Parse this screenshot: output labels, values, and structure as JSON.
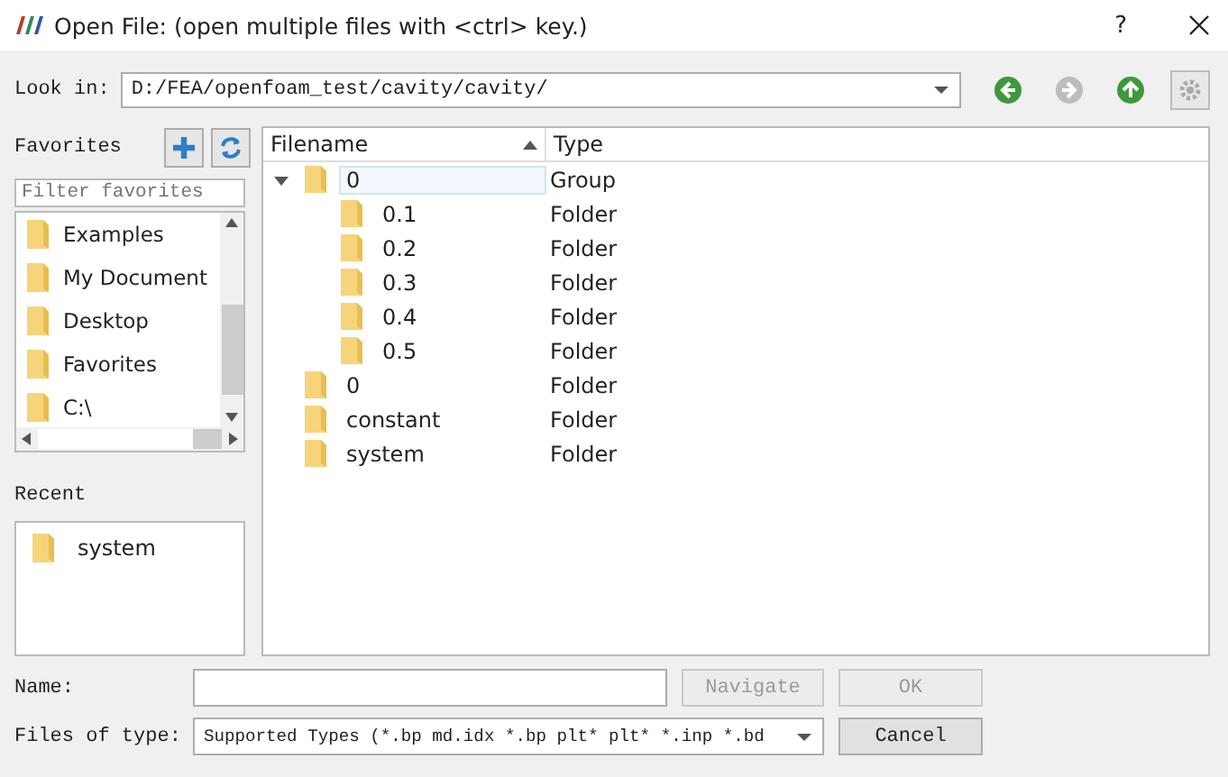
{
  "window": {
    "title": "Open File:  (open multiple files with <ctrl> key.)",
    "help": "?"
  },
  "look_in": {
    "label": "Look in:",
    "value": "D:/FEA/openfoam_test/cavity/cavity/"
  },
  "nav_buttons": [
    {
      "kind": "back",
      "disabled": false
    },
    {
      "kind": "forward",
      "disabled": true
    },
    {
      "kind": "up",
      "disabled": false
    },
    {
      "kind": "settings",
      "disabled": true
    }
  ],
  "favorites": {
    "label": "Favorites",
    "filter_placeholder": "Filter favorites",
    "items": [
      "Examples",
      "My Document",
      "Desktop",
      "Favorites",
      "C:\\"
    ]
  },
  "recent": {
    "label": "Recent",
    "items": [
      "system"
    ]
  },
  "file_table": {
    "columns": [
      {
        "label": "Filename",
        "sorted": true
      },
      {
        "label": "Type",
        "sorted": false
      }
    ],
    "rows": [
      {
        "name": "0",
        "type": "Group",
        "expanded": true,
        "selected": true,
        "children": [
          {
            "name": "0.1",
            "type": "Folder",
            "selected": false
          },
          {
            "name": "0.2",
            "type": "Folder",
            "selected": false
          },
          {
            "name": "0.3",
            "type": "Folder",
            "selected": false
          },
          {
            "name": "0.4",
            "type": "Folder",
            "selected": false
          },
          {
            "name": "0.5",
            "type": "Folder",
            "selected": false
          }
        ]
      },
      {
        "name": "0",
        "type": "Folder",
        "selected": false
      },
      {
        "name": "constant",
        "type": "Folder",
        "selected": false
      },
      {
        "name": "system",
        "type": "Folder",
        "selected": false
      }
    ]
  },
  "name_field": {
    "label": "Name:"
  },
  "file_type": {
    "label": "Files of type:",
    "value": "Supported Types (*.bp md.idx *.bp plt* plt* *.inp *.bd"
  },
  "buttons": [
    {
      "label": "Navigate",
      "disabled": true
    },
    {
      "label": "OK",
      "disabled": true
    },
    {
      "label": "Cancel",
      "disabled": false
    }
  ]
}
